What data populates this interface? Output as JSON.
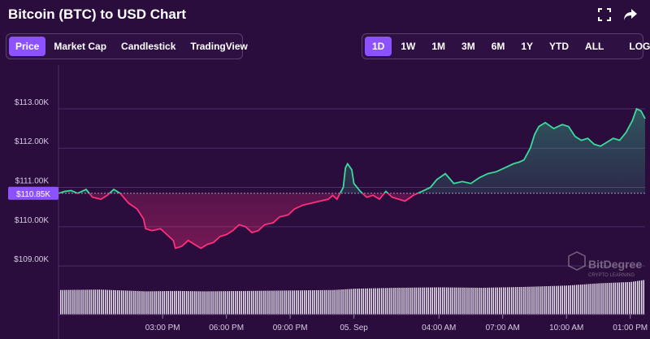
{
  "header": {
    "title": "Bitcoin (BTC) to USD Chart"
  },
  "icons": {
    "fullscreen": "fullscreen-icon",
    "share": "share-arrow-icon"
  },
  "chart_tabs": [
    "Price",
    "Market Cap",
    "Candlestick",
    "TradingView"
  ],
  "active_chart_tab": "Price",
  "ranges": [
    "1D",
    "1W",
    "1M",
    "3M",
    "6M",
    "1Y",
    "YTD",
    "ALL"
  ],
  "active_range": "1D",
  "scale_toggle": "LOG",
  "watermark": {
    "brand": "BitDegree",
    "tagline": "CRYPTO LEARNING"
  },
  "colors": {
    "background": "#2a0c3d",
    "accent": "#8c52ff",
    "up": "#3bdc9b",
    "down": "#ff2f7d"
  },
  "chart_data": {
    "type": "area",
    "ylim": [
      108900,
      113950
    ],
    "yticks": [
      {
        "value": 109000,
        "label": "$109.00K"
      },
      {
        "value": 110000,
        "label": "$110.00K"
      },
      {
        "value": 111000,
        "label": "$111.00K"
      },
      {
        "value": 112000,
        "label": "$112.00K"
      },
      {
        "value": 113000,
        "label": "$113.00K"
      }
    ],
    "xticks": [
      {
        "hour": 3,
        "label": "03:00 PM"
      },
      {
        "hour": 6,
        "label": "06:00 PM"
      },
      {
        "hour": 9,
        "label": "09:00 PM"
      },
      {
        "hour": 12,
        "label": "05. Sep"
      },
      {
        "hour": 16,
        "label": "04:00 AM"
      },
      {
        "hour": 19,
        "label": "07:00 AM"
      },
      {
        "hour": 22,
        "label": "10:00 AM"
      },
      {
        "hour": 25,
        "label": "01:00 PM"
      }
    ],
    "xlim": [
      -1.9,
      25.7
    ],
    "baseline": {
      "value": 110850,
      "label": "$110.85K"
    },
    "price": [
      [
        -1.9,
        110850
      ],
      [
        -1.6,
        110900
      ],
      [
        -1.3,
        110920
      ],
      [
        -1.0,
        110850
      ],
      [
        -0.6,
        110950
      ],
      [
        -0.3,
        110750
      ],
      [
        0.1,
        110700
      ],
      [
        0.4,
        110800
      ],
      [
        0.7,
        110950
      ],
      [
        1.0,
        110850
      ],
      [
        1.4,
        110600
      ],
      [
        1.8,
        110450
      ],
      [
        2.1,
        110200
      ],
      [
        2.2,
        109950
      ],
      [
        2.5,
        109900
      ],
      [
        2.9,
        109950
      ],
      [
        3.2,
        109800
      ],
      [
        3.5,
        109650
      ],
      [
        3.6,
        109450
      ],
      [
        3.9,
        109500
      ],
      [
        4.2,
        109650
      ],
      [
        4.5,
        109550
      ],
      [
        4.8,
        109450
      ],
      [
        5.1,
        109550
      ],
      [
        5.4,
        109600
      ],
      [
        5.7,
        109750
      ],
      [
        6.0,
        109800
      ],
      [
        6.3,
        109900
      ],
      [
        6.6,
        110050
      ],
      [
        6.9,
        110000
      ],
      [
        7.2,
        109850
      ],
      [
        7.5,
        109900
      ],
      [
        7.8,
        110050
      ],
      [
        8.2,
        110100
      ],
      [
        8.5,
        110250
      ],
      [
        8.9,
        110300
      ],
      [
        9.2,
        110450
      ],
      [
        9.6,
        110550
      ],
      [
        10.0,
        110600
      ],
      [
        10.4,
        110650
      ],
      [
        10.8,
        110700
      ],
      [
        11.0,
        110800
      ],
      [
        11.2,
        110700
      ],
      [
        11.4,
        110900
      ],
      [
        11.5,
        111000
      ],
      [
        11.6,
        111500
      ],
      [
        11.7,
        111600
      ],
      [
        11.9,
        111450
      ],
      [
        12.0,
        111100
      ],
      [
        12.3,
        110900
      ],
      [
        12.6,
        110750
      ],
      [
        12.9,
        110800
      ],
      [
        13.2,
        110700
      ],
      [
        13.5,
        110900
      ],
      [
        13.8,
        110750
      ],
      [
        14.1,
        110700
      ],
      [
        14.4,
        110650
      ],
      [
        14.8,
        110800
      ],
      [
        15.2,
        110900
      ],
      [
        15.6,
        111000
      ],
      [
        15.9,
        111200
      ],
      [
        16.3,
        111350
      ],
      [
        16.7,
        111100
      ],
      [
        17.1,
        111150
      ],
      [
        17.5,
        111100
      ],
      [
        17.9,
        111250
      ],
      [
        18.3,
        111350
      ],
      [
        18.7,
        111400
      ],
      [
        19.1,
        111500
      ],
      [
        19.5,
        111600
      ],
      [
        19.8,
        111650
      ],
      [
        20.0,
        111700
      ],
      [
        20.3,
        112000
      ],
      [
        20.5,
        112350
      ],
      [
        20.7,
        112550
      ],
      [
        21.0,
        112650
      ],
      [
        21.4,
        112500
      ],
      [
        21.8,
        112600
      ],
      [
        22.1,
        112550
      ],
      [
        22.4,
        112300
      ],
      [
        22.7,
        112200
      ],
      [
        23.0,
        112250
      ],
      [
        23.3,
        112100
      ],
      [
        23.6,
        112050
      ],
      [
        23.9,
        112150
      ],
      [
        24.2,
        112250
      ],
      [
        24.5,
        112200
      ],
      [
        24.8,
        112400
      ],
      [
        25.1,
        112700
      ],
      [
        25.3,
        113000
      ],
      [
        25.5,
        112950
      ],
      [
        25.7,
        112750
      ]
    ],
    "volume": [
      [
        -1.9,
        0.55
      ],
      [
        0.0,
        0.56
      ],
      [
        2.2,
        0.52
      ],
      [
        3.6,
        0.53
      ],
      [
        5.0,
        0.52
      ],
      [
        7.0,
        0.53
      ],
      [
        9.0,
        0.54
      ],
      [
        11.0,
        0.55
      ],
      [
        12.0,
        0.58
      ],
      [
        14.0,
        0.6
      ],
      [
        16.0,
        0.61
      ],
      [
        18.0,
        0.6
      ],
      [
        20.0,
        0.62
      ],
      [
        22.0,
        0.65
      ],
      [
        23.5,
        0.7
      ],
      [
        25.0,
        0.73
      ],
      [
        25.7,
        0.78
      ]
    ]
  }
}
